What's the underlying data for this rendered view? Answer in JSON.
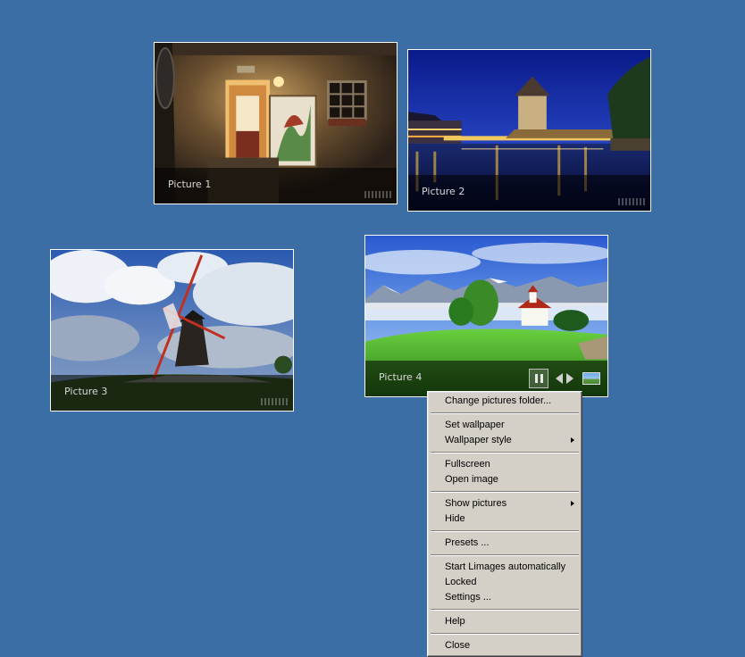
{
  "desktop": {
    "background": "#3a6ea5"
  },
  "pictures": [
    {
      "caption": "Picture 1"
    },
    {
      "caption": "Picture 2"
    },
    {
      "caption": "Picture 3"
    },
    {
      "caption": "Picture 4"
    }
  ],
  "picture_controls": {
    "pause_icon": "pause-icon",
    "prev_icon": "arrow-left-icon",
    "next_icon": "arrow-right-icon",
    "wallpaper_icon": "wallpaper-icon"
  },
  "context_menu": {
    "groups": [
      [
        {
          "label": "Change pictures folder..."
        }
      ],
      [
        {
          "label": "Set wallpaper"
        },
        {
          "label": "Wallpaper style",
          "submenu": true
        }
      ],
      [
        {
          "label": "Fullscreen"
        },
        {
          "label": "Open image"
        }
      ],
      [
        {
          "label": "Show pictures",
          "submenu": true
        },
        {
          "label": "Hide"
        }
      ],
      [
        {
          "label": "Presets ..."
        }
      ],
      [
        {
          "label": "Start Limages automatically"
        },
        {
          "label": "Locked"
        },
        {
          "label": "Settings ..."
        }
      ],
      [
        {
          "label": "Help"
        }
      ],
      [
        {
          "label": "Close"
        }
      ]
    ]
  }
}
